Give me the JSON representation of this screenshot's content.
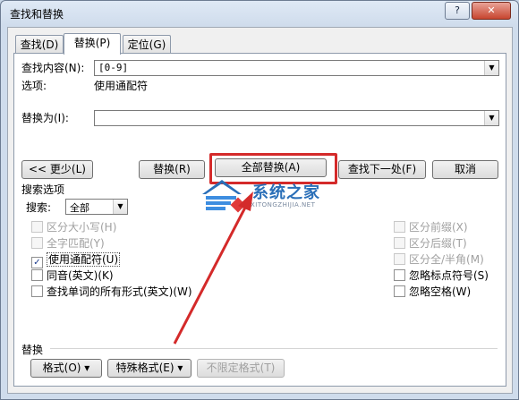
{
  "window": {
    "title": "查找和替换",
    "help_label": "?",
    "close_label": "✕"
  },
  "tabs": [
    {
      "label": "查找(D)"
    },
    {
      "label": "替换(P)"
    },
    {
      "label": "定位(G)"
    }
  ],
  "find": {
    "label": "查找内容(N):",
    "value": "[0-9]"
  },
  "options": {
    "label": "选项:",
    "value": "使用通配符"
  },
  "replace": {
    "label": "替换为(I):",
    "value": ""
  },
  "buttons": {
    "less": "<< 更少(L)",
    "replace": "替换(R)",
    "replace_all": "全部替换(A)",
    "find_next": "查找下一处(F)",
    "cancel": "取消"
  },
  "search_options": {
    "title": "搜索选项",
    "search_label": "搜索:",
    "search_value": "全部",
    "left": [
      {
        "label": "区分大小写(H)",
        "checked": false,
        "enabled": false
      },
      {
        "label": "全字匹配(Y)",
        "checked": false,
        "enabled": false
      },
      {
        "label": "使用通配符(U)",
        "checked": true,
        "enabled": true
      },
      {
        "label": "同音(英文)(K)",
        "checked": false,
        "enabled": true
      },
      {
        "label": "查找单词的所有形式(英文)(W)",
        "checked": false,
        "enabled": true
      }
    ],
    "right": [
      {
        "label": "区分前缀(X)",
        "checked": false,
        "enabled": false
      },
      {
        "label": "区分后缀(T)",
        "checked": false,
        "enabled": false
      },
      {
        "label": "区分全/半角(M)",
        "checked": false,
        "enabled": false
      },
      {
        "label": "忽略标点符号(S)",
        "checked": false,
        "enabled": true
      },
      {
        "label": "忽略空格(W)",
        "checked": false,
        "enabled": true
      }
    ]
  },
  "replace_section": {
    "title": "替换",
    "format": "格式(O) ▾",
    "special": "特殊格式(E) ▾",
    "no_format": "不限定格式(T)"
  },
  "watermark": {
    "title": "系统之家",
    "subtitle": "XITONGZHIJIA.NET"
  },
  "colors": {
    "highlight": "#d42a2a",
    "watermark": "#2a6fb8"
  }
}
